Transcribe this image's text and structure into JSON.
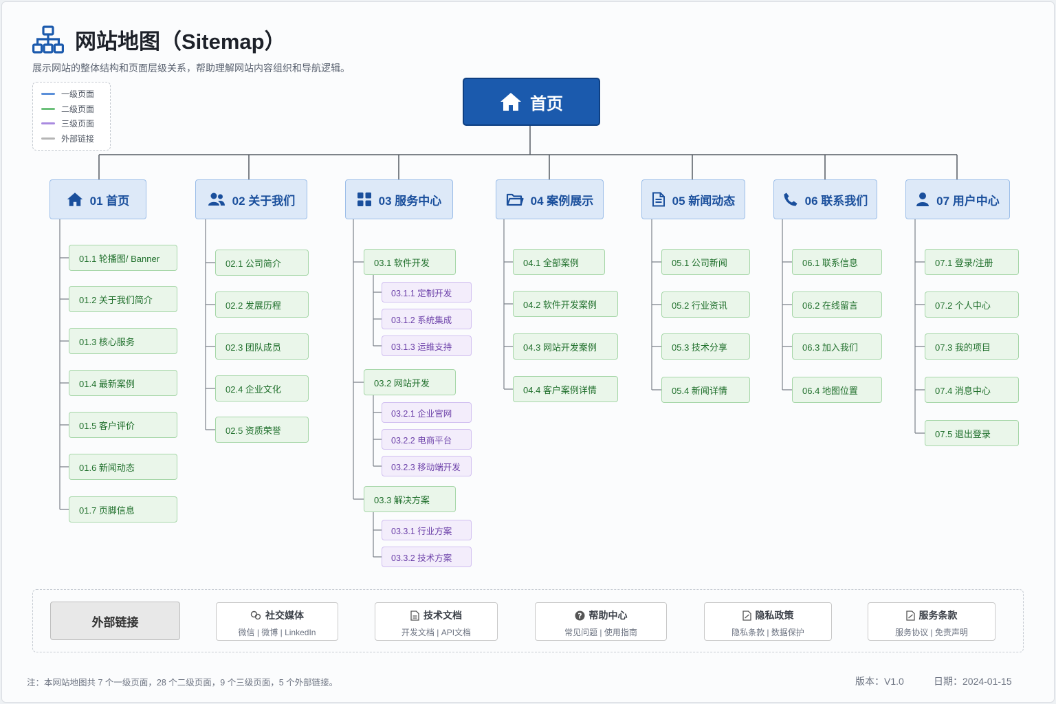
{
  "title": "网站地图（Sitemap）",
  "subtitle": "展示网站的整体结构和页面层级关系，帮助理解网站内容组织和导航逻辑。",
  "legend": [
    {
      "label": "一级页面",
      "color": "#5b8fd9"
    },
    {
      "label": "二级页面",
      "color": "#6cc07a"
    },
    {
      "label": "三级页面",
      "color": "#a98ae0"
    },
    {
      "label": "外部链接",
      "color": "#b5b5b5"
    }
  ],
  "root": {
    "label": "首页",
    "icon": "home-icon"
  },
  "sections": [
    {
      "label": "01 首页",
      "icon": "home-icon",
      "children": [
        {
          "label": "01.1 轮播图/ Banner"
        },
        {
          "label": "01.2 关于我们简介"
        },
        {
          "label": "01.3 核心服务"
        },
        {
          "label": "01.4 最新案例"
        },
        {
          "label": "01.5 客户评价"
        },
        {
          "label": "01.6 新闻动态"
        },
        {
          "label": "01.7 页脚信息"
        }
      ]
    },
    {
      "label": "02 关于我们",
      "icon": "users-icon",
      "children": [
        {
          "label": "02.1 公司简介"
        },
        {
          "label": "02.2 发展历程"
        },
        {
          "label": "02.3 团队成员"
        },
        {
          "label": "02.4 企业文化"
        },
        {
          "label": "02.5 资质荣誉"
        }
      ]
    },
    {
      "label": "03 服务中心",
      "icon": "grid-icon",
      "children": [
        {
          "label": "03.1 软件开发",
          "children": [
            {
              "label": "03.1.1 定制开发"
            },
            {
              "label": "03.1.2 系统集成"
            },
            {
              "label": "03.1.3 运维支持"
            }
          ]
        },
        {
          "label": "03.2 网站开发",
          "children": [
            {
              "label": "03.2.1 企业官网"
            },
            {
              "label": "03.2.2 电商平台"
            },
            {
              "label": "03.2.3 移动端开发"
            }
          ]
        },
        {
          "label": "03.3 解决方案",
          "children": [
            {
              "label": "03.3.1 行业方案"
            },
            {
              "label": "03.3.2 技术方案"
            }
          ]
        }
      ]
    },
    {
      "label": "04 案例展示",
      "icon": "folder-icon",
      "children": [
        {
          "label": "04.1 全部案例"
        },
        {
          "label": "04.2 软件开发案例"
        },
        {
          "label": "04.3 网站开发案例"
        },
        {
          "label": "04.4 客户案例详情"
        }
      ]
    },
    {
      "label": "05 新闻动态",
      "icon": "document-icon",
      "children": [
        {
          "label": "05.1 公司新闻"
        },
        {
          "label": "05.2 行业资讯"
        },
        {
          "label": "05.3 技术分享"
        },
        {
          "label": "05.4 新闻详情"
        }
      ]
    },
    {
      "label": "06 联系我们",
      "icon": "phone-icon",
      "children": [
        {
          "label": "06.1 联系信息"
        },
        {
          "label": "06.2 在线留言"
        },
        {
          "label": "06.3 加入我们"
        },
        {
          "label": "06.4 地图位置"
        }
      ]
    },
    {
      "label": "07 用户中心",
      "icon": "user-icon",
      "children": [
        {
          "label": "07.1 登录/注册"
        },
        {
          "label": "07.2 个人中心"
        },
        {
          "label": "07.3 我的项目"
        },
        {
          "label": "07.4 消息中心"
        },
        {
          "label": "07.5 退出登录"
        }
      ]
    }
  ],
  "external": {
    "label": "外部链接",
    "links": [
      {
        "title": "社交媒体",
        "sub": "微信 | 微博 | LinkedIn",
        "icon": "share-icon"
      },
      {
        "title": "技术文档",
        "sub": "开发文档 | API文档",
        "icon": "doc-icon"
      },
      {
        "title": "帮助中心",
        "sub": "常见问题 | 使用指南",
        "icon": "help-icon"
      },
      {
        "title": "隐私政策",
        "sub": "隐私条款 | 数据保护",
        "icon": "privacy-doc-icon"
      },
      {
        "title": "服务条款",
        "sub": "服务协议 | 免责声明",
        "icon": "terms-doc-icon"
      }
    ]
  },
  "footer": {
    "note": "注：本网站地图共 7 个一级页面，28 个二级页面，9 个三级页面，5 个外部链接。",
    "version": "版本：V1.0",
    "date": "日期：2024-01-15"
  }
}
